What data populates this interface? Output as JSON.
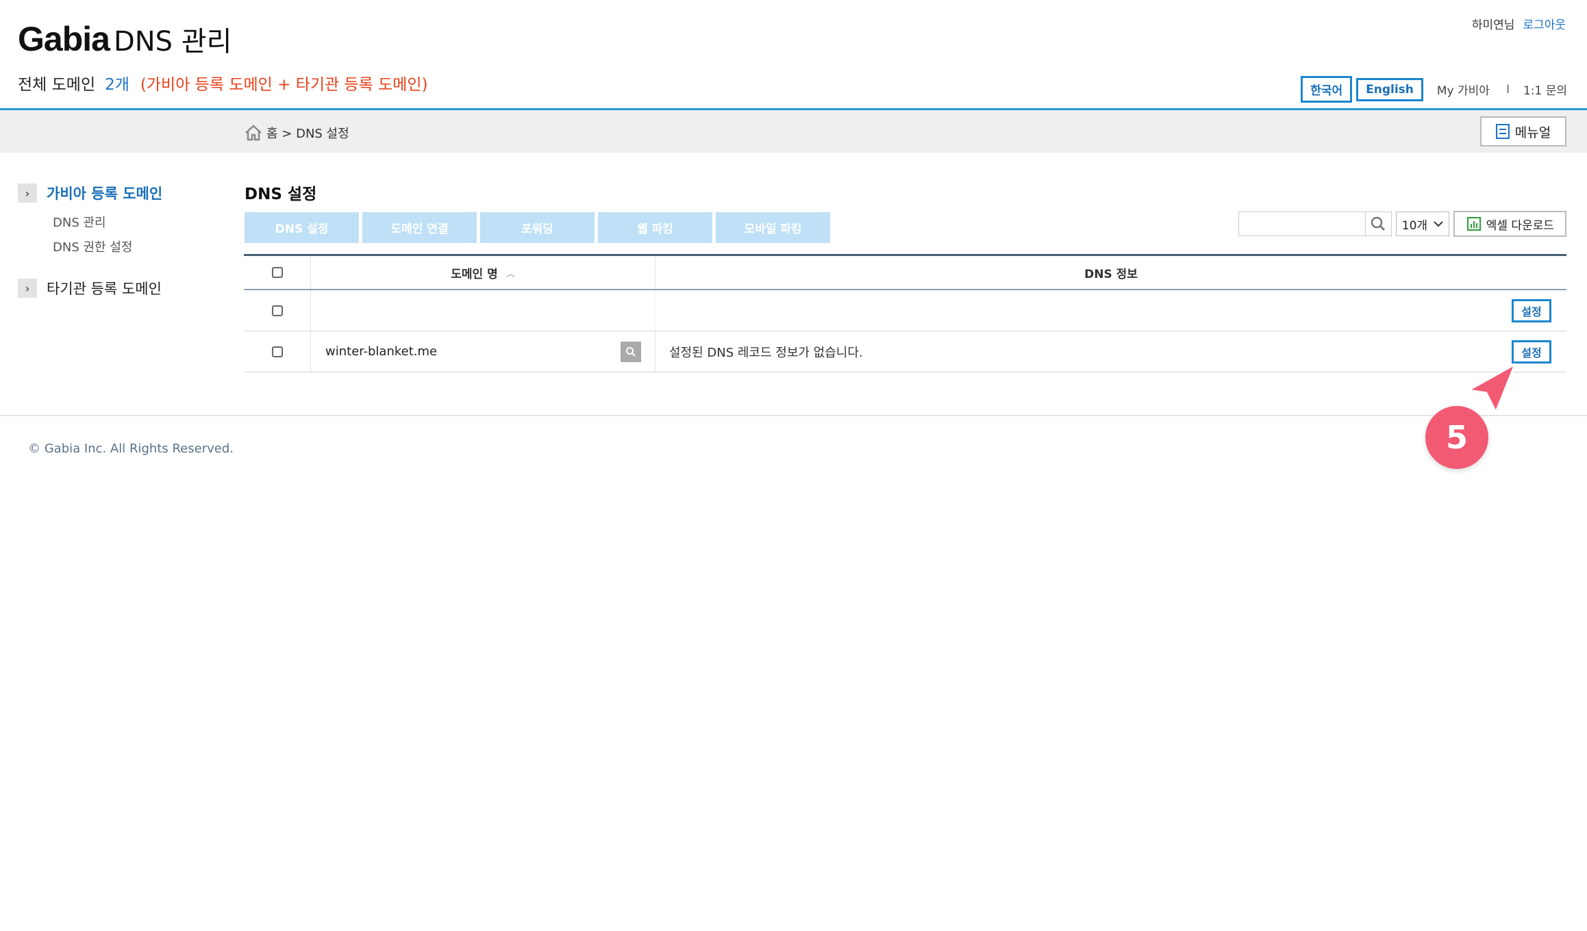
{
  "header": {
    "brand": "Gabia",
    "title": "DNS 관리",
    "summary_label": "전체 도메인",
    "summary_count": "2개",
    "summary_note": "(가비아 등록 도메인 + 타기관 등록 도메인)",
    "user_name": "하미연님",
    "logout": "로그아웃",
    "lang_ko": "한국어",
    "lang_en": "English",
    "my_gabia": "My 가비아",
    "separator": "I",
    "inquiry": "1:1 문의"
  },
  "breadcrumb": {
    "home_icon": "home-icon",
    "text": "홈 > DNS 설정",
    "manual": "메뉴얼"
  },
  "sidebar": {
    "groups": [
      {
        "label": "가비아 등록 도메인",
        "active": true,
        "items": [
          "DNS 관리",
          "DNS 권한 설정"
        ]
      },
      {
        "label": "타기관 등록 도메인",
        "active": false,
        "items": []
      }
    ]
  },
  "main": {
    "title": "DNS 설정",
    "tabs": [
      "DNS 설정",
      "도메인 연결",
      "포워딩",
      "웹 파킹",
      "모바일 파킹"
    ],
    "search_placeholder": "",
    "page_size": "10개",
    "excel": "엑셀 다운로드"
  },
  "table": {
    "headers": {
      "domain": "도메인 명",
      "dns": "DNS 정보"
    },
    "rows": [
      {
        "domain": "",
        "dns": "",
        "action": "설정"
      },
      {
        "domain": "winter-blanket.me",
        "dns": "설정된 DNS 레코드 정보가 없습니다.",
        "action": "설정"
      }
    ]
  },
  "footer": {
    "copyright": "© Gabia Inc. All Rights Reserved."
  },
  "overlay": {
    "step_number": "5",
    "color": "#f25a73"
  },
  "colors": {
    "accent_blue": "#1a86d0",
    "warning_red": "#e8421b",
    "tab_bg": "#bfe0f6"
  }
}
